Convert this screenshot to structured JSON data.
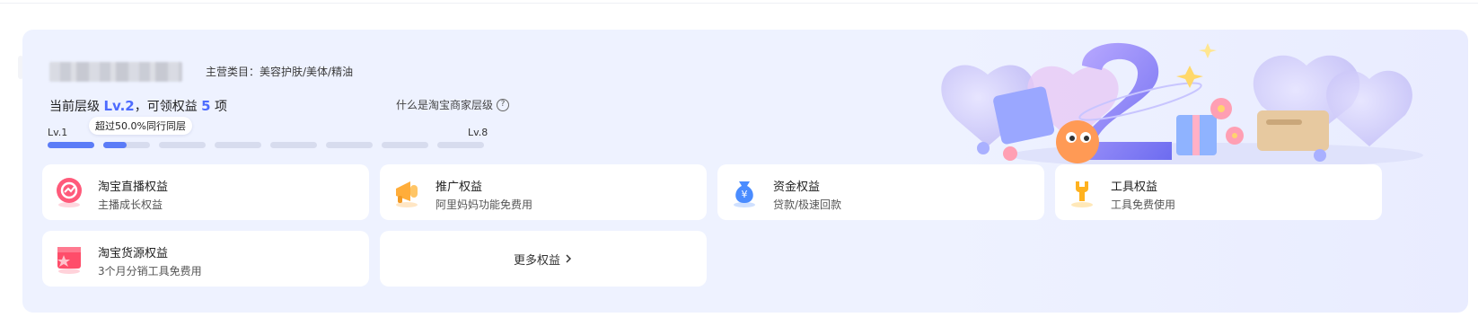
{
  "header": {
    "category_label": "主营类目：美容护肤/美体/精油"
  },
  "level": {
    "prefix": "当前层级",
    "current": "Lv.2",
    "middle": "，可领权益",
    "count": "5",
    "suffix": "项",
    "what_is": "什么是淘宝商家层级",
    "start_label": "Lv.1",
    "end_label": "Lv.8",
    "tooltip": "超过50.0%同行同层",
    "segments": [
      1,
      0.5,
      0,
      0,
      0,
      0,
      0,
      0
    ]
  },
  "benefits": [
    {
      "title": "淘宝直播权益",
      "subtitle": "主播成长权益",
      "icon": "live-stream-icon",
      "color": "#ff5a7a"
    },
    {
      "title": "推广权益",
      "subtitle": "阿里妈妈功能免费用",
      "icon": "megaphone-icon",
      "color": "#ffad3a"
    },
    {
      "title": "资金权益",
      "subtitle": "贷款/极速回款",
      "icon": "money-bag-icon",
      "color": "#4a8cff"
    },
    {
      "title": "工具权益",
      "subtitle": "工具免费使用",
      "icon": "wrench-icon",
      "color": "#ffb21f"
    },
    {
      "title": "淘宝货源权益",
      "subtitle": "3个月分销工具免费用",
      "icon": "gift-box-icon",
      "color": "#ff4d6a"
    }
  ],
  "more": {
    "label": "更多权益",
    "icon": "chevron-right-icon"
  },
  "accent": "#4d6bfe"
}
